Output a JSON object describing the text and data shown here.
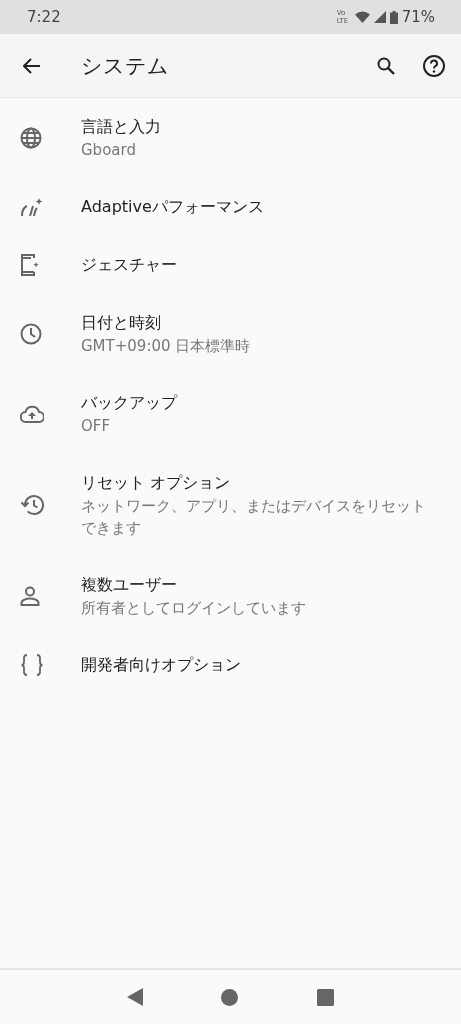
{
  "status_bar": {
    "time": "7:22",
    "volte": "Vo LTE",
    "battery": "71%"
  },
  "app_bar": {
    "title": "システム"
  },
  "items": [
    {
      "kind": "globe",
      "title": "言語と入力",
      "subtitle": "Gboard"
    },
    {
      "kind": "gauge",
      "title": "Adaptiveパフォーマンス"
    },
    {
      "kind": "phone",
      "title": "ジェスチャー"
    },
    {
      "kind": "clock",
      "title": "日付と時刻",
      "subtitle": "GMT+09:00 日本標準時"
    },
    {
      "kind": "cloud",
      "title": "バックアップ",
      "subtitle": "OFF"
    },
    {
      "kind": "history",
      "title": "リセット オプション",
      "subtitle": "ネットワーク、アプリ、またはデバイスをリセットできます"
    },
    {
      "kind": "person",
      "title": "複数ユーザー",
      "subtitle": "所有者としてログインしています"
    },
    {
      "kind": "braces",
      "title": "開発者向けオプション"
    }
  ]
}
